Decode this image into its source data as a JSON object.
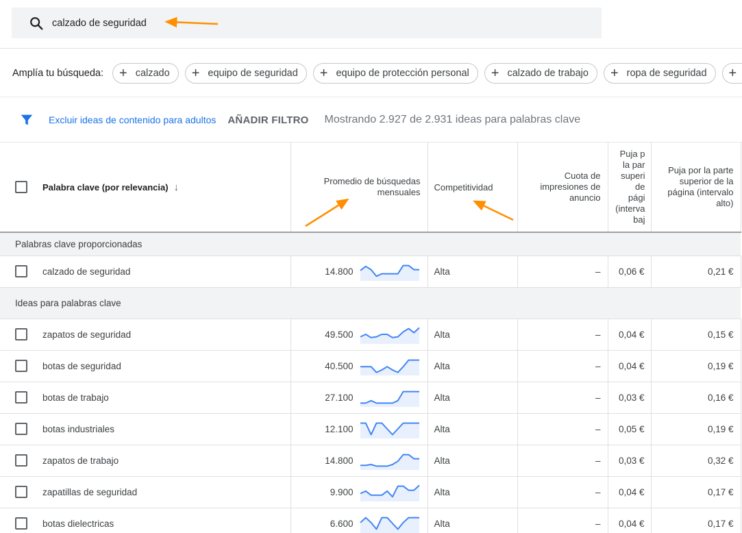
{
  "search": {
    "query": "calzado de seguridad",
    "icon": "search-icon"
  },
  "broaden": {
    "label": "Amplía tu búsqueda:",
    "chips": [
      {
        "label": "calzado"
      },
      {
        "label": "equipo de seguridad"
      },
      {
        "label": "equipo de protección personal"
      },
      {
        "label": "calzado de trabajo"
      },
      {
        "label": "ropa de seguridad"
      },
      {
        "label": ""
      }
    ]
  },
  "filters": {
    "exclude_label": "Excluir ideas de contenido para adultos",
    "add_filter": "AÑADIR FILTRO",
    "showing": "Mostrando 2.927 de 2.931 ideas para palabras clave"
  },
  "table": {
    "headers": {
      "keyword": "Palabra clave (por relevancia)",
      "volume_1": "Promedio de búsquedas",
      "volume_2": "mensuales",
      "competition": "Competitividad",
      "share_1": "Cuota de",
      "share_2": "impresiones de",
      "share_3": "anuncio",
      "low_1": "Puja p",
      "low_2": "la par",
      "low_3": "superi",
      "low_4": "de",
      "low_5": "pági",
      "low_6": "(interva",
      "low_7": "baj",
      "high_1": "Puja por la parte",
      "high_2": "superior de la",
      "high_3": "página (intervalo",
      "high_4": "alto)"
    },
    "groups": {
      "provided": "Palabras clave proporcionadas",
      "ideas": "Ideas para palabras clave"
    },
    "provided_rows": [
      {
        "keyword": "calzado de seguridad",
        "volume": "14.800",
        "trend": [
          0.55,
          0.8,
          0.6,
          0.2,
          0.35,
          0.35,
          0.35,
          0.35,
          0.85,
          0.85,
          0.6,
          0.6
        ],
        "competition": "Alta",
        "share": "–",
        "low": "0,06 €",
        "high": "0,21 €"
      }
    ],
    "rows": [
      {
        "keyword": "zapatos de seguridad",
        "volume": "49.500",
        "trend": [
          0.35,
          0.5,
          0.3,
          0.35,
          0.5,
          0.5,
          0.3,
          0.35,
          0.65,
          0.85,
          0.6,
          0.9
        ],
        "competition": "Alta",
        "share": "–",
        "low": "0,04 €",
        "high": "0,15 €"
      },
      {
        "keyword": "botas de seguridad",
        "volume": "40.500",
        "trend": [
          0.45,
          0.45,
          0.45,
          0.1,
          0.25,
          0.45,
          0.25,
          0.1,
          0.45,
          0.85,
          0.85,
          0.85
        ],
        "competition": "Alta",
        "share": "–",
        "low": "0,04 €",
        "high": "0,19 €"
      },
      {
        "keyword": "botas de trabajo",
        "volume": "27.100",
        "trend": [
          0.15,
          0.15,
          0.3,
          0.15,
          0.15,
          0.15,
          0.15,
          0.3,
          0.85,
          0.85,
          0.85,
          0.85
        ],
        "competition": "Alta",
        "share": "–",
        "low": "0,03 €",
        "high": "0,16 €"
      },
      {
        "keyword": "botas industriales",
        "volume": "12.100",
        "trend": [
          0.85,
          0.85,
          0.15,
          0.85,
          0.85,
          0.5,
          0.15,
          0.5,
          0.85,
          0.85,
          0.85,
          0.85
        ],
        "competition": "Alta",
        "share": "–",
        "low": "0,05 €",
        "high": "0,19 €"
      },
      {
        "keyword": "zapatos de trabajo",
        "volume": "14.800",
        "trend": [
          0.2,
          0.2,
          0.25,
          0.15,
          0.15,
          0.15,
          0.25,
          0.45,
          0.85,
          0.85,
          0.6,
          0.6
        ],
        "competition": "Alta",
        "share": "–",
        "low": "0,03 €",
        "high": "0,32 €"
      },
      {
        "keyword": "zapatillas de seguridad",
        "volume": "9.900",
        "trend": [
          0.4,
          0.55,
          0.3,
          0.3,
          0.3,
          0.55,
          0.2,
          0.85,
          0.85,
          0.6,
          0.6,
          0.9
        ],
        "competition": "Alta",
        "share": "–",
        "low": "0,04 €",
        "high": "0,17 €"
      },
      {
        "keyword": "botas dielectricas",
        "volume": "6.600",
        "trend": [
          0.55,
          0.85,
          0.55,
          0.15,
          0.85,
          0.85,
          0.5,
          0.15,
          0.55,
          0.85,
          0.85,
          0.85
        ],
        "competition": "Alta",
        "share": "–",
        "low": "0,04 €",
        "high": "0,17 €"
      }
    ]
  },
  "colors": {
    "link_blue": "#1a73e8",
    "trend_line": "#4285f4",
    "trend_fill": "#e8f0fe",
    "annotation_orange": "#ff8f00"
  }
}
